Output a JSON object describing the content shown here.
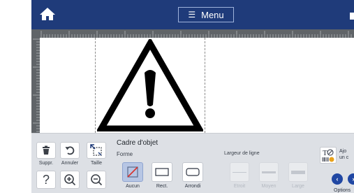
{
  "topbar": {
    "menu_label": "Menu"
  },
  "tools": {
    "delete_label": "Suppr.",
    "undo_label": "Annuler",
    "resize_label": "Taille"
  },
  "panel": {
    "title": "Cadre d'objet",
    "shape_section": "Forme",
    "line_width_section": "Largeur de ligne",
    "shapes": [
      {
        "label": "Aucun",
        "selected": true
      },
      {
        "label": "Rect.",
        "selected": false
      },
      {
        "label": "Arrondi",
        "selected": false
      }
    ],
    "line_widths": [
      {
        "label": "Etroit",
        "enabled": false
      },
      {
        "label": "Moyen",
        "enabled": false
      },
      {
        "label": "Large",
        "enabled": false
      }
    ],
    "add_label_line1": "Ajo",
    "add_label_line2": "un c",
    "options_label": "Options"
  },
  "colors": {
    "topbar": "#1f3b7a",
    "accent": "#2047a3",
    "selected": "#b7c6e4",
    "warning_red": "#d9312b"
  },
  "icons": {
    "home": "home-icon",
    "menu": "hamburger-icon",
    "delete": "trash-icon",
    "undo": "undo-icon",
    "resize": "resize-icon",
    "help": "question-icon",
    "zoom_in": "zoom-in-icon",
    "zoom_out": "zoom-out-icon",
    "none_shape": "no-frame-icon",
    "rect_shape": "rectangle-icon",
    "rounded_shape": "rounded-rectangle-icon",
    "add_object": "text-barcode-icon",
    "prev": "chevron-left-icon",
    "next": "chevron-right-icon",
    "warning": "warning-triangle-icon"
  }
}
